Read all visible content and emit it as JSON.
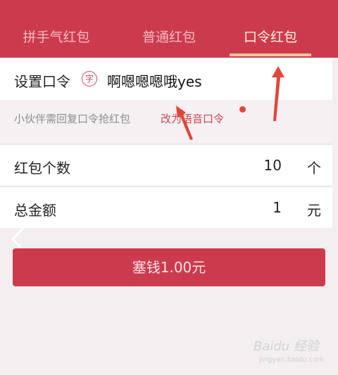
{
  "tabs": [
    {
      "label": "拼手气红包",
      "active": false
    },
    {
      "label": "普通红包",
      "active": false
    },
    {
      "label": "口令红包",
      "active": true
    }
  ],
  "password": {
    "label": "设置口令",
    "badge": "字",
    "value": "啊嗯嗯嗯哦yes"
  },
  "hint": {
    "text": "小伙伴需回复口令抢红包",
    "link": "改为语音口令"
  },
  "count": {
    "label": "红包个数",
    "value": "10",
    "unit": "个"
  },
  "total": {
    "label": "总金额",
    "value": "1",
    "unit": "元"
  },
  "submit": {
    "label": "塞钱1.00元"
  },
  "watermark": {
    "text": "Baidu 经验",
    "sub": "jingyan.baidu.com"
  },
  "colors": {
    "brand": "#cc3b4d",
    "accent_underline": "#f6c79c",
    "annotation": "#e2453a"
  },
  "icons": {
    "back": "chevron-left-icon",
    "badge": "character-badge-icon"
  }
}
